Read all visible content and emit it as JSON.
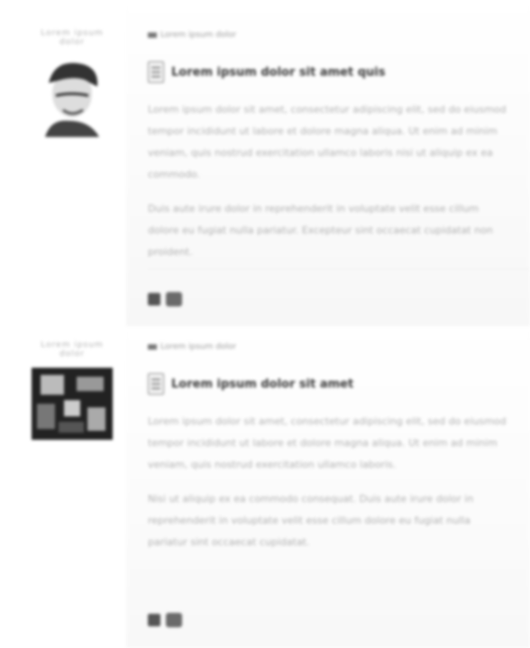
{
  "posts": [
    {
      "username": "Lorem ipsum dolor",
      "date": "Lorem ipsum dolor",
      "title": "Lorem ipsum dolor sit amet quis",
      "paragraphs": [
        "Lorem ipsum dolor sit amet, consectetur adipiscing elit, sed do eiusmod tempor incididunt ut labore et dolore magna aliqua. Ut enim ad minim veniam, quis nostrud exercitation ullamco laboris nisi ut aliquip ex ea commodo.",
        "Duis aute irure dolor in reprehenderit in voluptate velit esse cillum dolore eu fugiat nulla pariatur. Excepteur sint occaecat cupidatat non proident."
      ],
      "avatar": "portrait-sketch"
    },
    {
      "username": "Lorem ipsum dolor",
      "date": "Lorem ipsum dolor",
      "title": "Lorem ipsum dolor sit amet",
      "paragraphs": [
        "Lorem ipsum dolor sit amet, consectetur adipiscing elit, sed do eiusmod tempor incididunt ut labore et dolore magna aliqua. Ut enim ad minim veniam, quis nostrud exercitation ullamco laboris.",
        "Nisi ut aliquip ex ea commodo consequat. Duis aute irure dolor in reprehenderit in voluptate velit esse cillum dolore eu fugiat nulla pariatur sint occaecat cupidatat."
      ],
      "avatar": "abstract-image"
    }
  ],
  "icons": {
    "reply": "reply-icon",
    "quote": "quote-icon"
  }
}
